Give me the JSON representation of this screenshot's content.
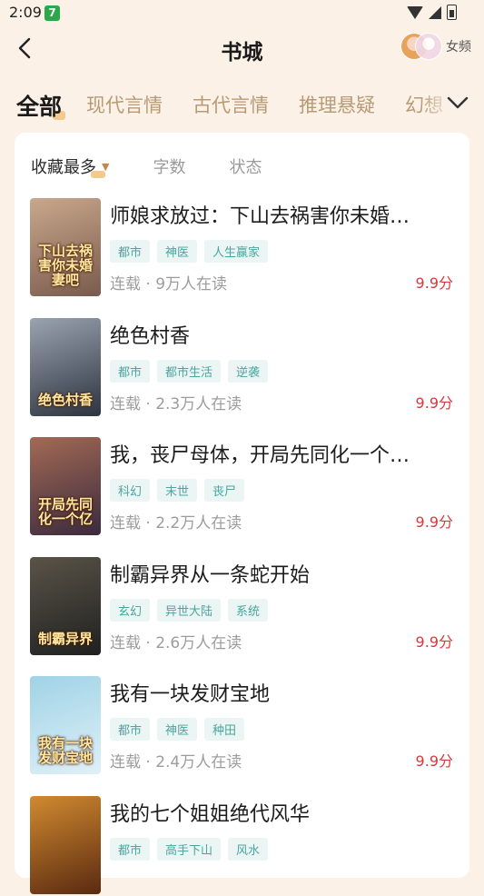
{
  "status_bar": {
    "time": "2:09",
    "app_badge": "7"
  },
  "header": {
    "title": "书城",
    "channel_label": "女频"
  },
  "tabs": [
    "全部",
    "现代言情",
    "古代言情",
    "推理悬疑",
    "幻想"
  ],
  "sort": [
    {
      "label": "收藏最多",
      "active": true
    },
    {
      "label": "字数",
      "active": false
    },
    {
      "label": "状态",
      "active": false
    }
  ],
  "books": [
    {
      "title": "师娘求放过：下山去祸害你未婚…",
      "tags": [
        "都市",
        "神医",
        "人生赢家"
      ],
      "meta": "连载 · 9万人在读",
      "score": "9.9分",
      "cover_text": "下山去祸害你未婚妻吧",
      "cover_colors": [
        "#7a5a4c",
        "#c9a88c"
      ]
    },
    {
      "title": "绝色村香",
      "tags": [
        "都市",
        "都市生活",
        "逆袭"
      ],
      "meta": "连载 · 2.3万人在读",
      "score": "9.9分",
      "cover_text": "绝色村香",
      "cover_colors": [
        "#2d3440",
        "#9aa3b0"
      ]
    },
    {
      "title": "我，丧尸母体，开局先同化一个…",
      "tags": [
        "科幻",
        "末世",
        "丧尸"
      ],
      "meta": "连载 · 2.2万人在读",
      "score": "9.9分",
      "cover_text": "开局先同化一个亿",
      "cover_colors": [
        "#3b2a3e",
        "#a36a54"
      ]
    },
    {
      "title": "制霸异界从一条蛇开始",
      "tags": [
        "玄幻",
        "异世大陆",
        "系统"
      ],
      "meta": "连载 · 2.6万人在读",
      "score": "9.9分",
      "cover_text": "制霸异界",
      "cover_colors": [
        "#1f2120",
        "#5a5347"
      ]
    },
    {
      "title": "我有一块发财宝地",
      "tags": [
        "都市",
        "神医",
        "种田"
      ],
      "meta": "连载 · 2.4万人在读",
      "score": "9.9分",
      "cover_text": "我有一块发财宝地",
      "cover_colors": [
        "#dff0f8",
        "#9fd3e6"
      ]
    },
    {
      "title": "我的七个姐姐绝代风华",
      "tags": [
        "都市",
        "高手下山",
        "风水"
      ],
      "meta": "",
      "score": "",
      "cover_text": "",
      "cover_colors": [
        "#5a2a10",
        "#d08a30"
      ]
    }
  ]
}
